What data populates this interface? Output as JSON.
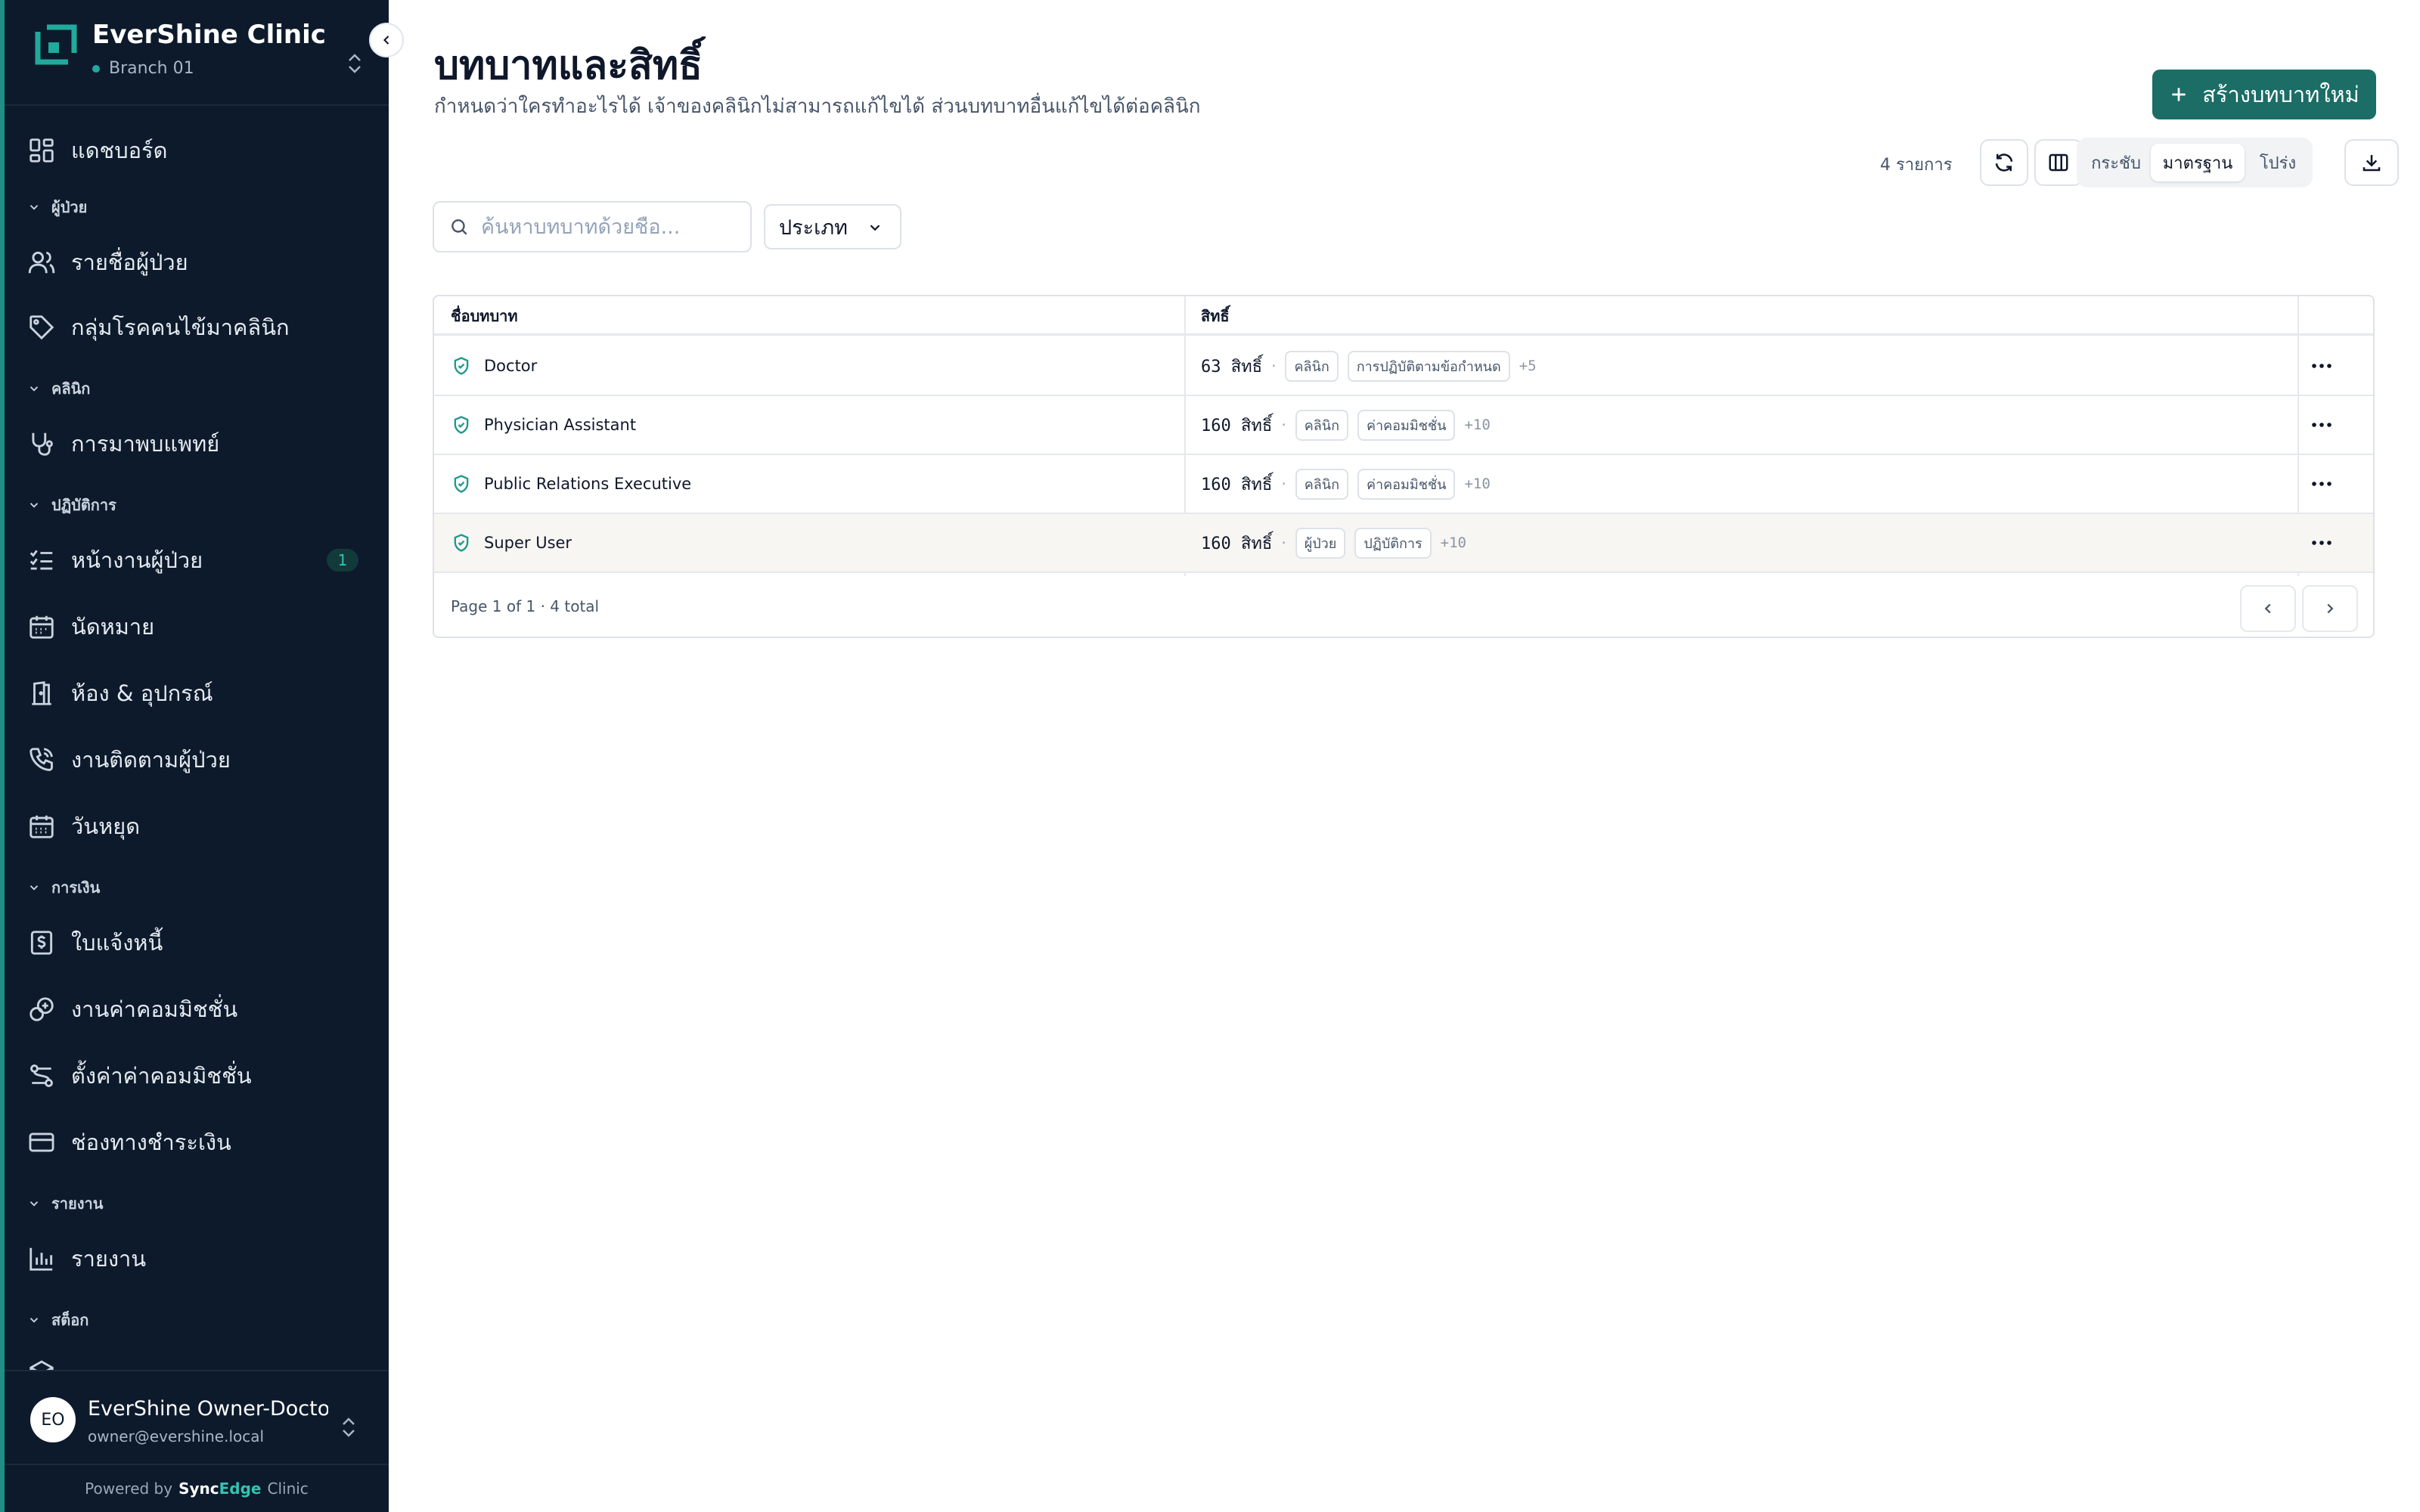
{
  "brand": {
    "name": "EverShine Clinic",
    "branch": "Branch 01"
  },
  "nav": {
    "dashboard": "แดชบอร์ด",
    "sections": {
      "patients": "ผู้ป่วย",
      "clinic": "คลินิก",
      "operations": "ปฏิบัติการ",
      "finance": "การเงิน",
      "reports": "รายงาน",
      "stock": "สต็อก"
    },
    "items": {
      "patient_list": "รายชื่อผู้ป่วย",
      "disease_groups": "กลุ่มโรคคนไข้มาคลินิก",
      "doctor_visits": "การมาพบแพทย์",
      "patient_tasks": "หน้างานผู้ป่วย",
      "patient_tasks_badge": "1",
      "appointments": "นัดหมาย",
      "rooms_equipment": "ห้อง & อุปกรณ์",
      "patient_followup": "งานติดตามผู้ป่วย",
      "holidays": "วันหยุด",
      "invoices": "ใบแจ้งหนี้",
      "commission_work": "งานค่าคอมมิชชั่น",
      "commission_settings": "ตั้งค่าค่าคอมมิชชั่น",
      "payment_channels": "ช่องทางชำระเงิน",
      "reports": "รายงาน"
    }
  },
  "user": {
    "initials": "EO",
    "name": "EverShine Owner-Doctor",
    "email": "owner@evershine.local"
  },
  "footer": {
    "powered_prefix": "Powered by",
    "sync": "Sync",
    "edge": "Edge",
    "clinic": "Clinic"
  },
  "page": {
    "title": "บทบาทและสิทธิ์",
    "subtitle": "กำหนดว่าใครทำอะไรได้ เจ้าของคลินิกไม่สามารถแก้ไขได้ ส่วนบทบาทอื่นแก้ไขได้ต่อคลินิก",
    "create_button": "สร้างบทบาทใหม่"
  },
  "toolbar": {
    "count": "4 รายการ",
    "density": {
      "compact": "กระชับ",
      "standard": "มาตรฐาน",
      "loose": "โปร่ง"
    }
  },
  "filters": {
    "search_placeholder": "ค้นหาบทบาทด้วยชื่อ...",
    "type_label": "ประเภท"
  },
  "table": {
    "headers": {
      "role": "ชื่อบทบาท",
      "permissions": "สิทธิ์"
    },
    "rows": [
      {
        "name": "Doctor",
        "perm_count": "63 สิทธิ์",
        "chips": [
          "คลินิก",
          "การปฏิบัติตามข้อกำหนด"
        ],
        "more": "+5"
      },
      {
        "name": "Physician Assistant",
        "perm_count": "160 สิทธิ์",
        "chips": [
          "คลินิก",
          "ค่าคอมมิชชั่น"
        ],
        "more": "+10"
      },
      {
        "name": "Public Relations Executive",
        "perm_count": "160 สิทธิ์",
        "chips": [
          "คลินิก",
          "ค่าคอมมิชชั่น"
        ],
        "more": "+10"
      },
      {
        "name": "Super User",
        "perm_count": "160 สิทธิ์",
        "chips": [
          "ผู้ป่วย",
          "ปฏิบัติการ"
        ],
        "more": "+10"
      }
    ],
    "pagination": "Page 1 of 1 · 4 total"
  },
  "colors": {
    "sidebar_bg": "#0d1a2b",
    "accent": "#1b6d66",
    "accent_light": "#22a99b",
    "row_highlight": "#f7f6f3"
  }
}
